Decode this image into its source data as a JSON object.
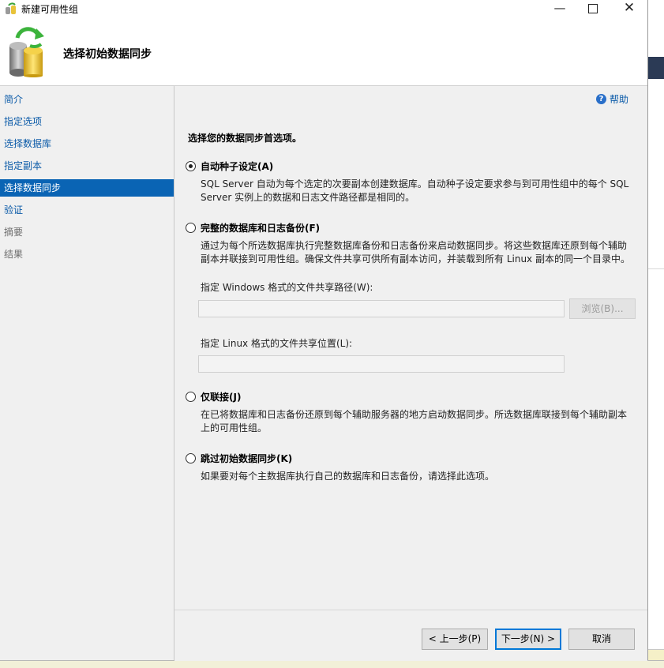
{
  "window": {
    "title": "新建可用性组",
    "minimize": "—",
    "close": "✕"
  },
  "header": {
    "title": "选择初始数据同步"
  },
  "nav": {
    "items": [
      {
        "label": "简介",
        "state": "link"
      },
      {
        "label": "指定选项",
        "state": "link"
      },
      {
        "label": "选择数据库",
        "state": "link"
      },
      {
        "label": "指定副本",
        "state": "link"
      },
      {
        "label": "选择数据同步",
        "state": "selected"
      },
      {
        "label": "验证",
        "state": "link"
      },
      {
        "label": "摘要",
        "state": "disabled"
      },
      {
        "label": "结果",
        "state": "disabled"
      }
    ]
  },
  "help": {
    "label": "帮助",
    "icon": "?"
  },
  "main": {
    "prompt": "选择您的数据同步首选项。",
    "options": [
      {
        "label": "自动种子设定(A)",
        "selected": true,
        "description": "SQL Server 自动为每个选定的次要副本创建数据库。自动种子设定要求参与到可用性组中的每个 SQL Server 实例上的数据和日志文件路径都是相同的。"
      },
      {
        "label": "完整的数据库和日志备份(F)",
        "selected": false,
        "description": "通过为每个所选数据库执行完整数据库备份和日志备份来启动数据同步。将这些数据库还原到每个辅助副本并联接到可用性组。确保文件共享可供所有副本访问，并装载到所有 Linux 副本的同一个目录中。"
      },
      {
        "label": "仅联接(J)",
        "selected": false,
        "description": "在已将数据库和日志备份还原到每个辅助服务器的地方启动数据同步。所选数据库联接到每个辅助副本上的可用性组。"
      },
      {
        "label": "跳过初始数据同步(K)",
        "selected": false,
        "description": "如果要对每个主数据库执行自己的数据库和日志备份，请选择此选项。"
      }
    ],
    "windows_share_label": "指定 Windows 格式的文件共享路径(W):",
    "windows_share_value": "",
    "browse_label": "浏览(B)...",
    "linux_share_label": "指定 Linux 格式的文件共享位置(L):",
    "linux_share_value": ""
  },
  "footer": {
    "prev": "< 上一步(P)",
    "next": "下一步(N) >",
    "cancel": "取消"
  }
}
